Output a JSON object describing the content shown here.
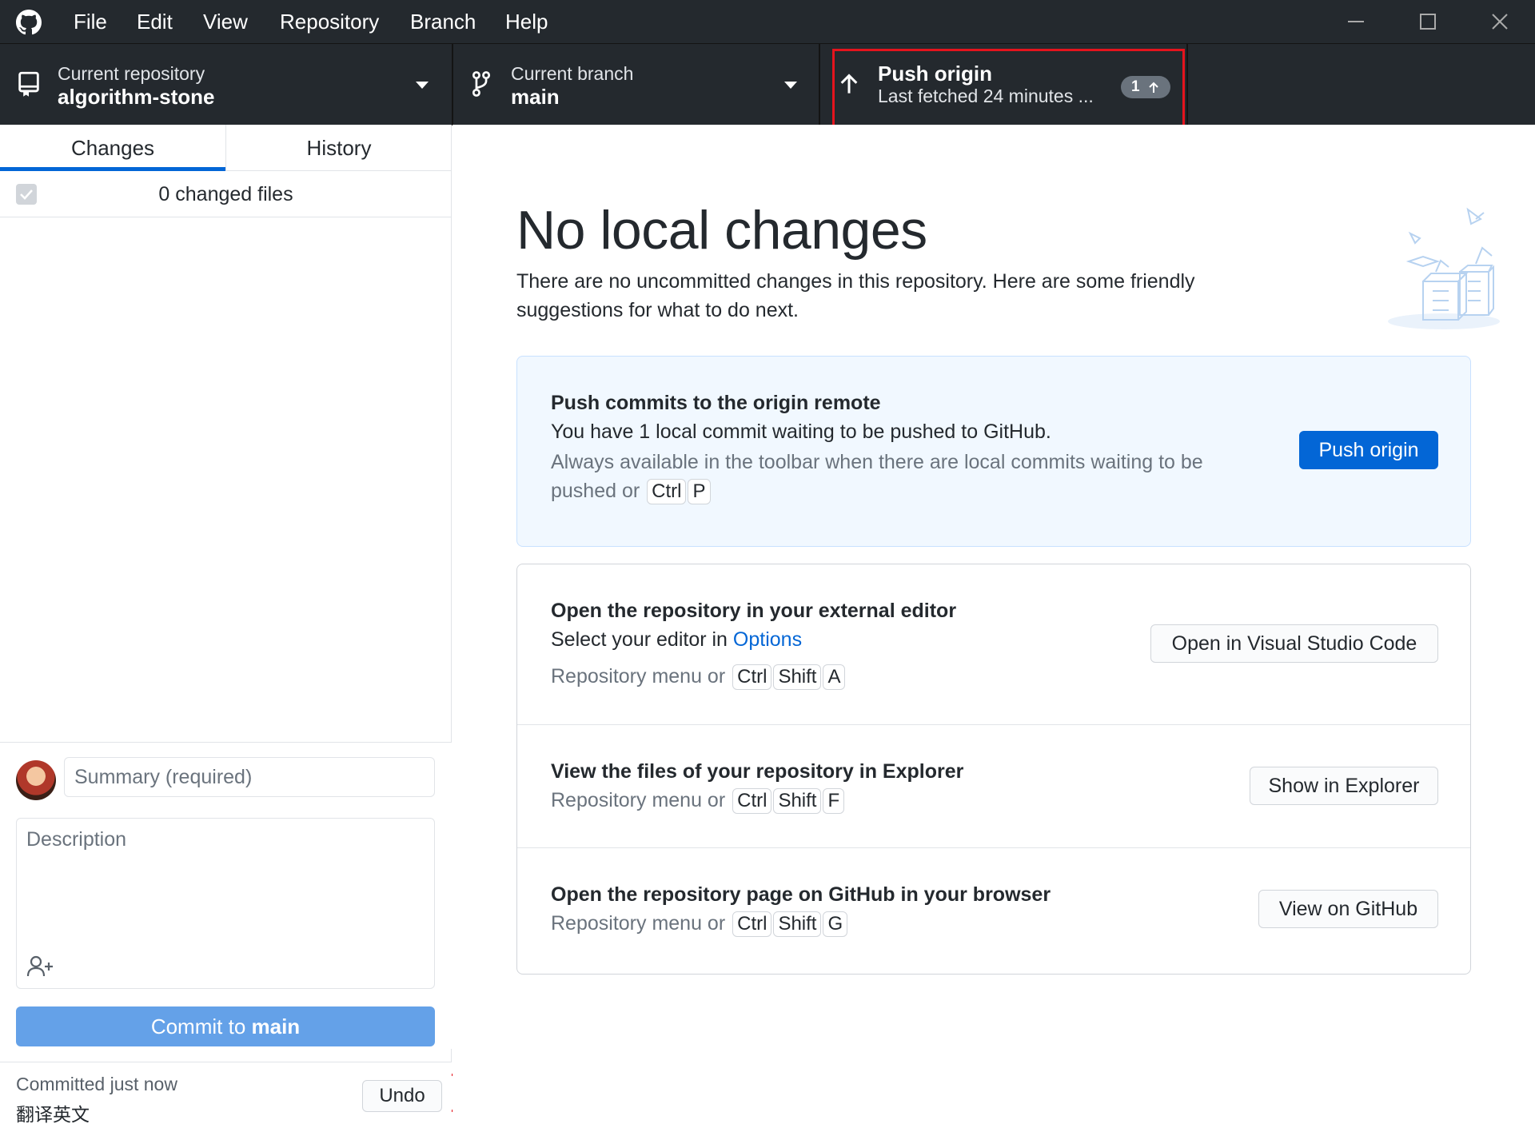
{
  "menu": [
    "File",
    "Edit",
    "View",
    "Repository",
    "Branch",
    "Help"
  ],
  "toolbar": {
    "repo_label": "Current repository",
    "repo_name": "algorithm-stone",
    "branch_label": "Current branch",
    "branch_name": "main",
    "push_title": "Push origin",
    "push_subtitle": "Last fetched 24 minutes ...",
    "push_badge": "1"
  },
  "sidebar": {
    "tabs": [
      "Changes",
      "History"
    ],
    "changed_files": "0 changed files",
    "summary_placeholder": "Summary (required)",
    "description_placeholder": "Description",
    "commit_prefix": "Commit to ",
    "commit_branch": "main",
    "last_commit_time": "Committed just now",
    "last_commit_message": "翻译英文",
    "undo_label": "Undo"
  },
  "main": {
    "title": "No local changes",
    "subtitle": "There are no uncommitted changes in this repository. Here are some friendly suggestions for what to do next.",
    "push_card": {
      "title": "Push commits to the origin remote",
      "desc": "You have 1 local commit waiting to be pushed to GitHub.",
      "hint": "Always available in the toolbar when there are local commits waiting to be pushed or",
      "keys": [
        "Ctrl",
        "P"
      ],
      "button": "Push origin"
    },
    "editor_card": {
      "title": "Open the repository in your external editor",
      "desc_prefix": "Select your editor in ",
      "desc_link": "Options",
      "hint": "Repository menu or",
      "keys": [
        "Ctrl",
        "Shift",
        "A"
      ],
      "button": "Open in Visual Studio Code"
    },
    "explorer_card": {
      "title": "View the files of your repository in Explorer",
      "hint": "Repository menu or",
      "keys": [
        "Ctrl",
        "Shift",
        "F"
      ],
      "button": "Show in Explorer"
    },
    "github_card": {
      "title": "Open the repository page on GitHub in your browser",
      "hint": "Repository menu or",
      "keys": [
        "Ctrl",
        "Shift",
        "G"
      ],
      "button": "View on GitHub"
    }
  },
  "colors": {
    "titlebar": "#24292e",
    "accent": "#0366d6",
    "commit_button": "#64a1e8",
    "highlight": "#e5141d"
  }
}
